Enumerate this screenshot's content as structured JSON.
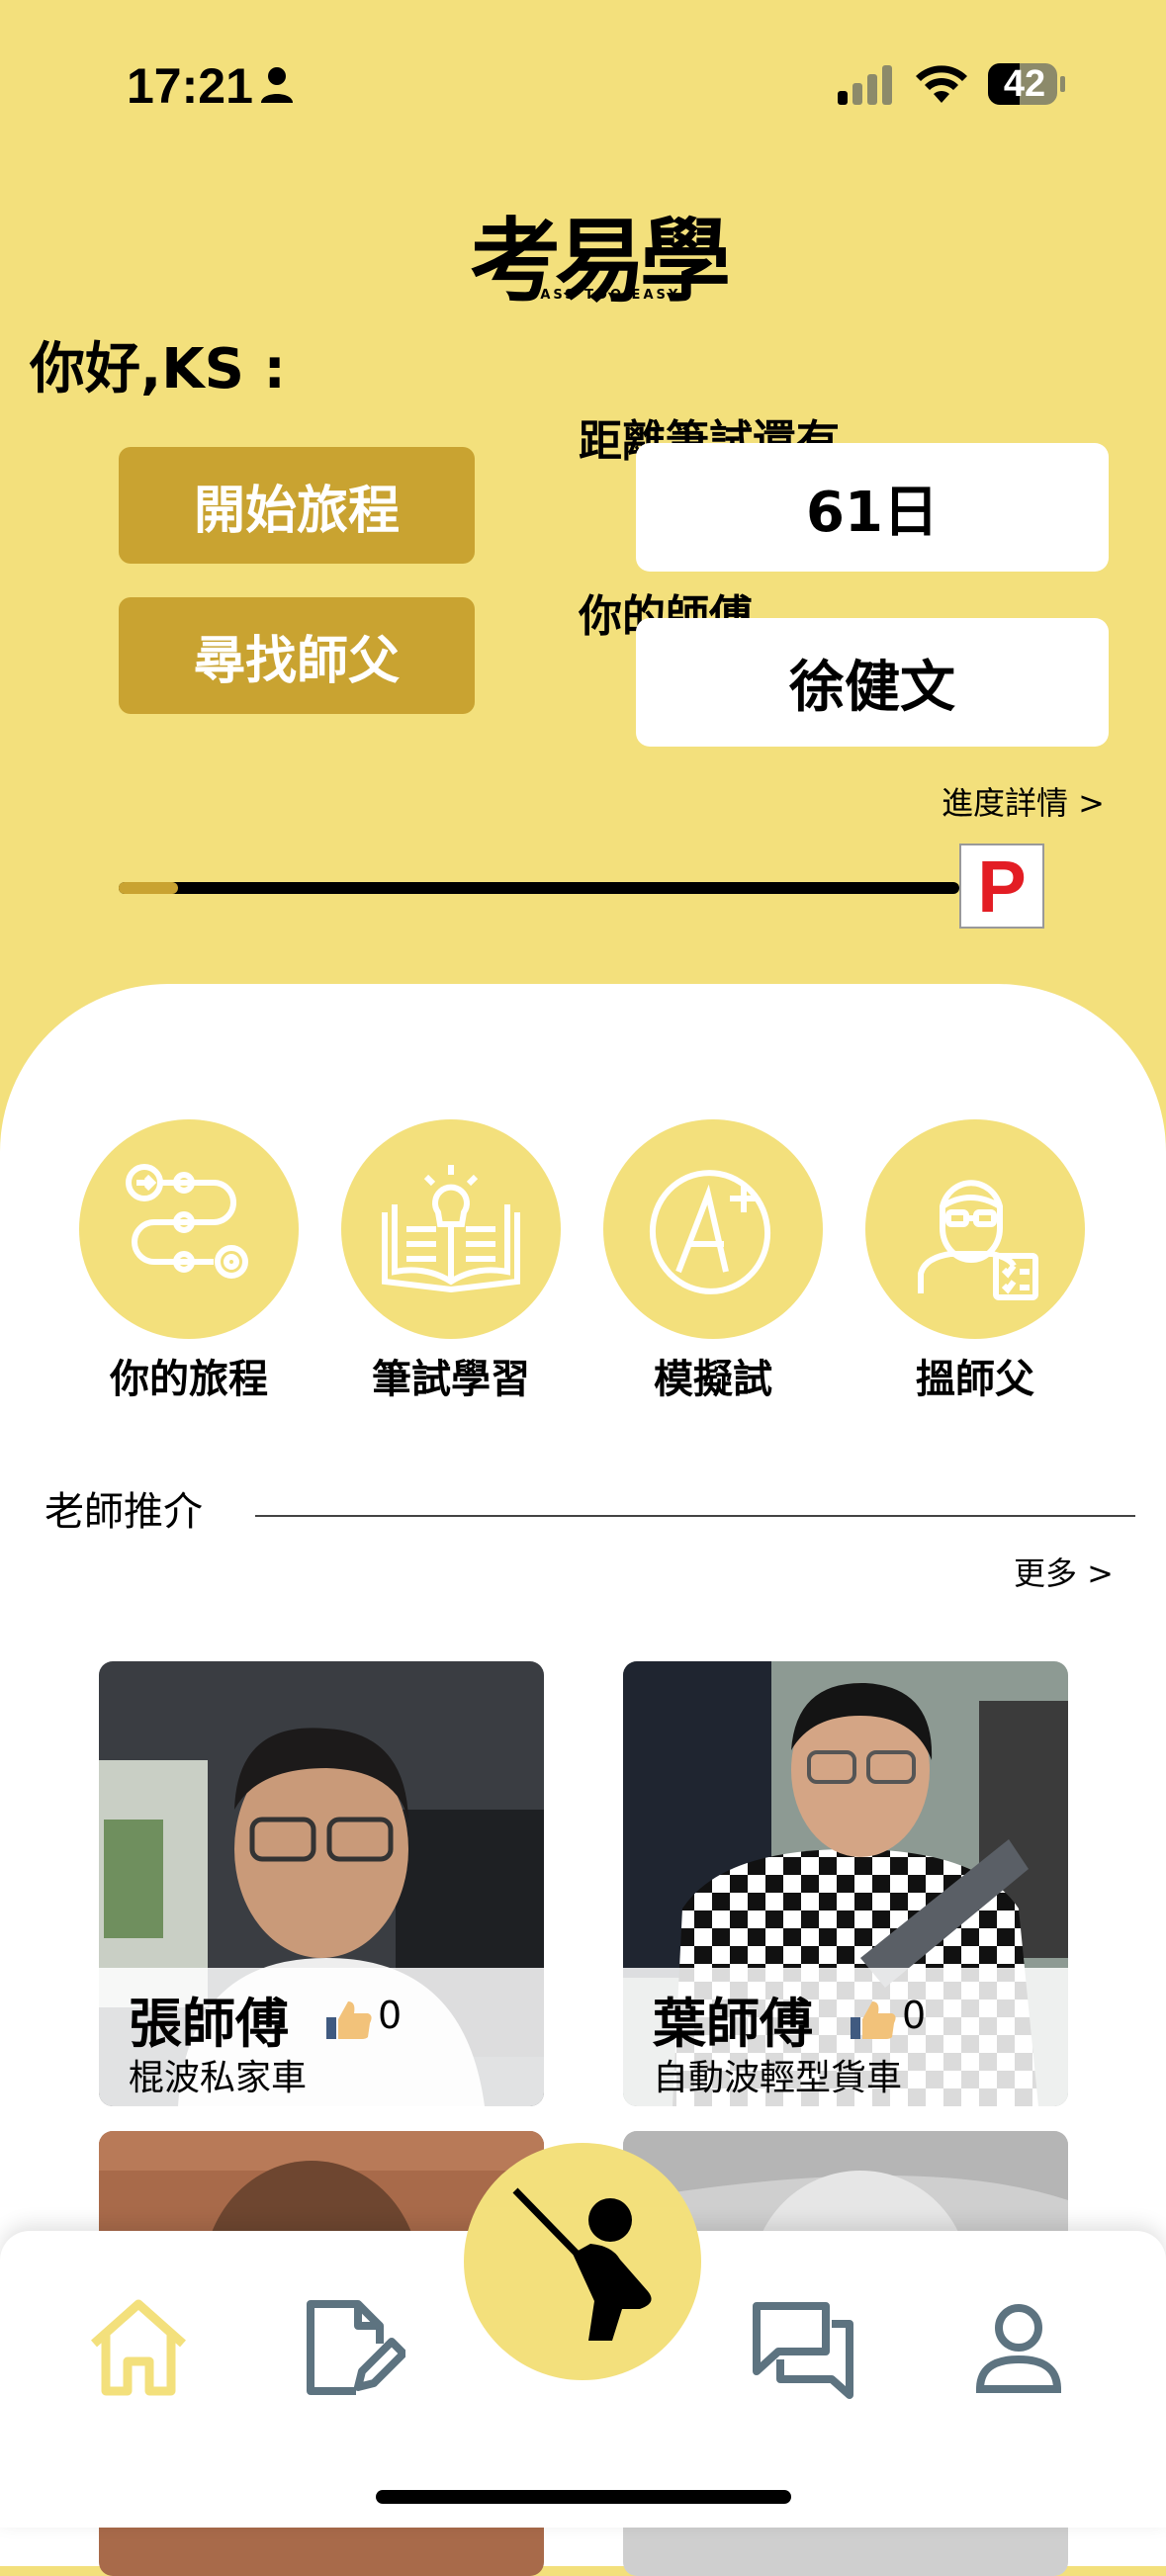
{
  "status_bar": {
    "time": "17:21",
    "battery": "42"
  },
  "brand": {
    "logo_text": "考易學",
    "logo_sub": "PASS TOO EASY"
  },
  "greeting": "你好,KS :",
  "actions": {
    "start_journey": "開始旅程",
    "find_master": "尋找師父"
  },
  "exam": {
    "label": "距離筆試還有",
    "value": "61日"
  },
  "master": {
    "label": "你的師傅",
    "value": "徐健文"
  },
  "progress": {
    "link": "進度詳情 >",
    "fraction": 0.07,
    "plate": "P"
  },
  "features": [
    {
      "label": "你的旅程",
      "icon": "journey-route-icon"
    },
    {
      "label": "筆試學習",
      "icon": "book-lightbulb-icon"
    },
    {
      "label": "模擬試",
      "icon": "grade-a-plus-icon"
    },
    {
      "label": "搵師父",
      "icon": "instructor-clipboard-icon"
    }
  ],
  "teachers": {
    "title": "老師推介",
    "more": "更多 >",
    "cards": [
      {
        "name": "張師傅",
        "likes": "0",
        "type": "棍波私家車"
      },
      {
        "name": "葉師傅",
        "likes": "0",
        "type": "自動波輕型貨車"
      }
    ]
  },
  "nav": {
    "items": [
      "home-icon",
      "edit-note-icon",
      "teacher-pointer-icon",
      "chat-icon",
      "profile-icon"
    ]
  },
  "colors": {
    "primary_yellow": "#f3e07c",
    "gold": "#c9a331",
    "plate_red": "#e31d24",
    "nav_icon": "#5d7380"
  }
}
